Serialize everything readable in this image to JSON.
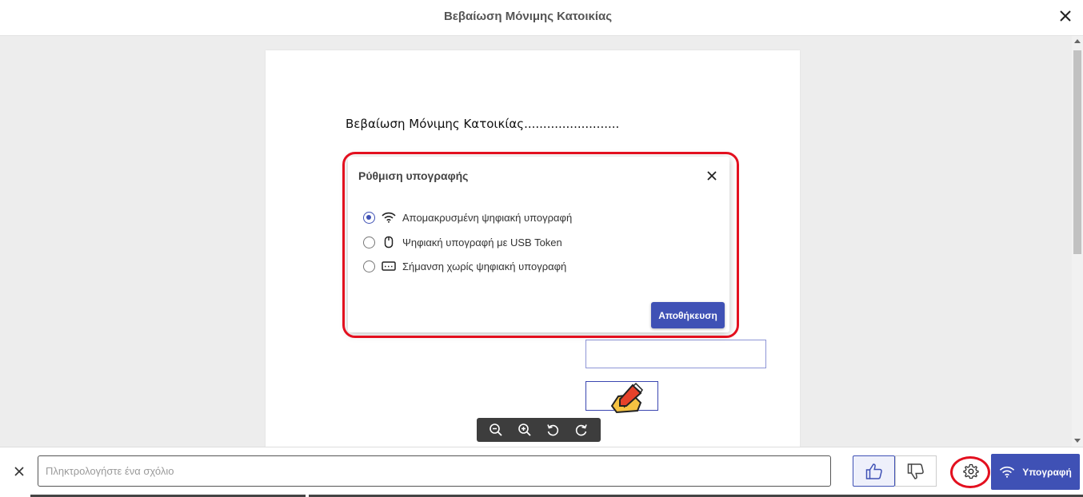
{
  "window": {
    "title": "Βεβαίωση Μόνιμης Κατοικίας"
  },
  "document": {
    "heading": "Βεβαίωση Μόνιμης Κατοικίας........................."
  },
  "dialog": {
    "title": "Ρύθμιση υπογραφής",
    "options": [
      {
        "label": "Απομακρυσμένη ψηφιακή υπογραφή",
        "icon": "wifi-icon",
        "selected": true
      },
      {
        "label": "Ψηφιακή υπογραφή με USB Token",
        "icon": "usb-mouse-icon",
        "selected": false
      },
      {
        "label": "Σήμανση χωρίς ψηφιακή υπογραφή",
        "icon": "keyboard-icon",
        "selected": false
      }
    ],
    "save_label": "Αποθήκευση"
  },
  "zoom_toolbar": {
    "icons": [
      "zoom-out-icon",
      "zoom-in-icon",
      "rotate-left-icon",
      "rotate-right-icon"
    ]
  },
  "bottom_bar": {
    "comment_placeholder": "Πληκτρολογήστε ένα σχόλιο",
    "comment_value": "",
    "sign_label": "Υπογραφή"
  },
  "colors": {
    "accent": "#3f51b5",
    "highlight": "#e3101f",
    "viewer_bg": "#ededed"
  }
}
